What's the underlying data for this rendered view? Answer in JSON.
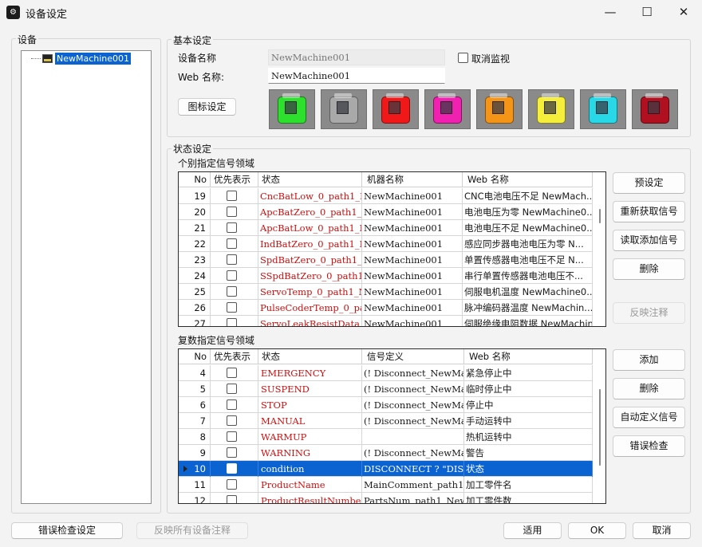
{
  "window": {
    "title": "设备设定",
    "app_icon": "device-settings-icon",
    "minimize": "—",
    "maximize": "☐",
    "close": "✕"
  },
  "device_group": {
    "label": "设备",
    "tree": [
      {
        "label": "NewMachine001",
        "icon": "machine-icon",
        "selected": true
      }
    ]
  },
  "basic": {
    "label": "基本设定",
    "device_name_label": "设备名称",
    "device_name_value": "NewMachine001",
    "web_name_label": "Web 名称:",
    "web_name_value": "NewMachine001",
    "cancel_monitor_label": "取消监视",
    "cancel_monitor_checked": false,
    "icon_setting_button": "图标设定",
    "icon_colors": [
      "#2ee02e",
      "#a9a9a9",
      "#f01818",
      "#f020b0",
      "#f59518",
      "#f5ee3a",
      "#28d8e6",
      "#b01020"
    ]
  },
  "status": {
    "label": "状态设定",
    "individual": {
      "label": "个别指定信号领域",
      "columns": [
        "No",
        "优先表示",
        "状态",
        "机器名称",
        "Web 名称"
      ],
      "rows": [
        {
          "no": "19",
          "status": "CncBatLow_0_path1_N...",
          "machine": "NewMachine001",
          "web": "CNC电池电压不足 NewMach..."
        },
        {
          "no": "20",
          "status": "ApcBatZero_0_path1_N...",
          "machine": "NewMachine001",
          "web": "电池电压为零 NewMachine0..."
        },
        {
          "no": "21",
          "status": "ApcBatLow_0_path1_N...",
          "machine": "NewMachine001",
          "web": "电池电压不足 NewMachine0..."
        },
        {
          "no": "22",
          "status": "IndBatZero_0_path1_N...",
          "machine": "NewMachine001",
          "web": "感应同步器电池电压为零 N..."
        },
        {
          "no": "23",
          "status": "SpdBatZero_0_path1_N...",
          "machine": "NewMachine001",
          "web": "单置传感器电池电压不足 N..."
        },
        {
          "no": "24",
          "status": "SSpdBatZero_0_path1_...",
          "machine": "NewMachine001",
          "web": "串行单置传感器电池电压不..."
        },
        {
          "no": "25",
          "status": "ServoTemp_0_path1_N...",
          "machine": "NewMachine001",
          "web": "伺服电机温度 NewMachine0..."
        },
        {
          "no": "26",
          "status": "PulseCoderTemp_0_pat...",
          "machine": "NewMachine001",
          "web": "脉冲编码器温度 NewMachin..."
        },
        {
          "no": "27",
          "status": "ServoLeakResistData_0...",
          "machine": "NewMachine001",
          "web": "伺服绝缘电阻数据 NewMachin..."
        }
      ],
      "buttons": [
        "预设定",
        "重新获取信号",
        "读取添加信号",
        "删除"
      ],
      "reflect_button": "反映注释"
    },
    "multiple": {
      "label": "复数指定信号领域",
      "columns": [
        "No",
        "优先表示",
        "状态",
        "信号定义",
        "Web 名称"
      ],
      "rows": [
        {
          "no": "4",
          "status": "EMERGENCY",
          "signal": "(! Disconnect_NewMac...",
          "web": "紧急停止中"
        },
        {
          "no": "5",
          "status": "SUSPEND",
          "signal": "(! Disconnect_NewMac...",
          "web": "临时停止中"
        },
        {
          "no": "6",
          "status": "STOP",
          "signal": "(! Disconnect_NewMac...",
          "web": "停止中"
        },
        {
          "no": "7",
          "status": "MANUAL",
          "signal": "(! Disconnect_NewMac...",
          "web": "手动运转中"
        },
        {
          "no": "8",
          "status": "WARMUP",
          "signal": "",
          "web": "热机运转中"
        },
        {
          "no": "9",
          "status": "WARNING",
          "signal": "(! Disconnect_NewMac...",
          "web": "警告"
        },
        {
          "no": "10",
          "status": "condition",
          "signal": "DISCONNECT ? \"DIS...",
          "web": "状态",
          "selected": true
        },
        {
          "no": "11",
          "status": "ProductName",
          "signal": "MainComment_path1_...",
          "web": "加工零件名"
        },
        {
          "no": "12",
          "status": "ProductResultNumber",
          "signal": "PartsNum_path1_New...",
          "web": "加工零件数"
        }
      ],
      "buttons": [
        "添加",
        "删除",
        "自动定义信号",
        "错误检查"
      ]
    }
  },
  "footer": {
    "error_check_settings": "错误检查设定",
    "reflect_all": "反映所有设备注释",
    "apply": "适用",
    "ok": "OK",
    "cancel": "取消"
  }
}
